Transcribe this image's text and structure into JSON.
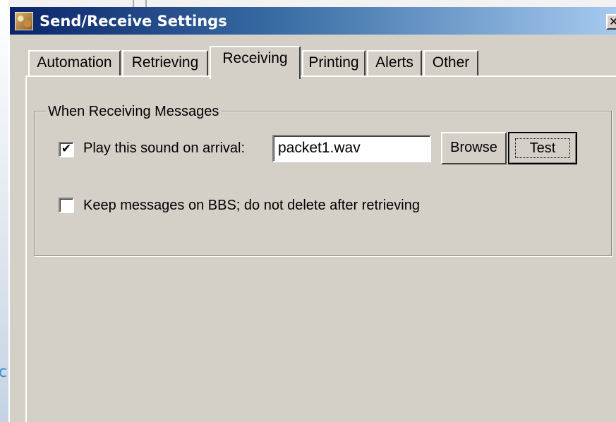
{
  "window": {
    "title": "Send/Receive Settings",
    "close_glyph": "✕"
  },
  "background": {
    "partial_glyph": "c"
  },
  "tabs": [
    {
      "label": "Automation",
      "active": false
    },
    {
      "label": "Retrieving",
      "active": false
    },
    {
      "label": "Receiving",
      "active": true
    },
    {
      "label": "Printing",
      "active": false
    },
    {
      "label": "Alerts",
      "active": false
    },
    {
      "label": "Other",
      "active": false
    }
  ],
  "receiving": {
    "group_title": "When Receiving Messages",
    "play_sound": {
      "label": "Play this sound on arrival:",
      "checked": true,
      "check_glyph": "✔"
    },
    "sound_file": "packet1.wav",
    "browse_label": "Browse",
    "test_label": "Test",
    "keep_messages": {
      "label": "Keep messages on BBS; do not delete after retrieving",
      "checked": false,
      "check_glyph": ""
    }
  },
  "colors": {
    "titlebar_start": "#0a246a",
    "titlebar_end": "#a6caf0",
    "dialog_face": "#d4d0c8"
  }
}
